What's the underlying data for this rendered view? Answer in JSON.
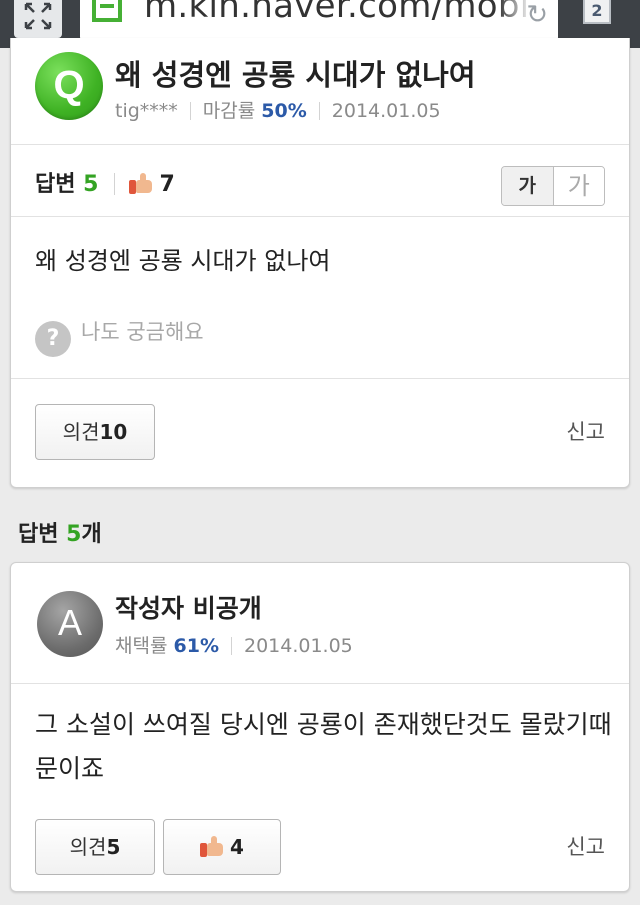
{
  "browser": {
    "url": "m.kin.naver.com/mobile",
    "tab_count": "2",
    "refresh_icon": "refresh-icon"
  },
  "question": {
    "avatar_letter": "Q",
    "title": "왜 성경엔 공룡 시대가 없나여",
    "author": "tig****",
    "close_rate_label": "마감률",
    "close_rate": "50%",
    "date": "2014.01.05",
    "answers_label": "답변",
    "answers_count": "5",
    "likes": "7",
    "font_small_label": "가",
    "font_large_label": "가",
    "body": "왜 성경엔 공룡 시대가 없나여",
    "curious_icon": "?",
    "curious_label": "나도 궁금해요",
    "opinion_label": "의견",
    "opinion_count": "10",
    "report_label": "신고"
  },
  "answers_header": {
    "label": "답변",
    "count": "5",
    "suffix": "개"
  },
  "answer": {
    "avatar_letter": "A",
    "author": "작성자 비공개",
    "adopt_rate_label": "채택률",
    "adopt_rate": "61%",
    "date": "2014.01.05",
    "body": "그 소설이 쓰여질 당시엔 공룡이 존재했단것도 몰랐기때문이죠",
    "opinion_label": "의견",
    "opinion_count": "5",
    "likes": "4",
    "report_label": "신고"
  },
  "colors": {
    "browser_bar": "#3d4146",
    "accent_green": "#34a323",
    "rate_blue": "#2c5aa8",
    "page_background": "#ebebeb"
  }
}
